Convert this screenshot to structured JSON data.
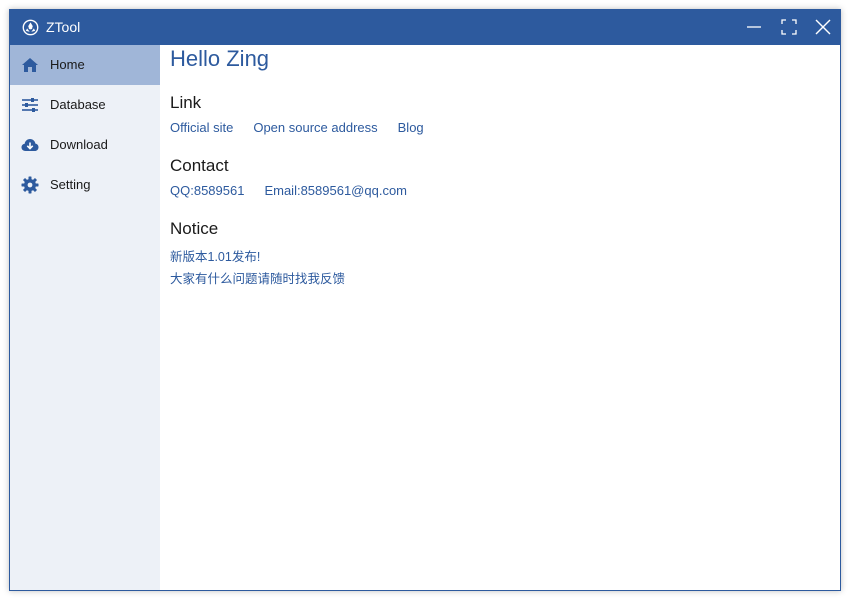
{
  "window": {
    "title": "ZTool",
    "accent_color": "#2d5a9e",
    "sidebar_bg": "#edf1f7",
    "active_item_bg": "#a0b6d8"
  },
  "sidebar": {
    "items": [
      {
        "label": "Home",
        "icon": "home-icon",
        "active": true
      },
      {
        "label": "Database",
        "icon": "sliders-icon",
        "active": false
      },
      {
        "label": "Download",
        "icon": "cloud-download-icon",
        "active": false
      },
      {
        "label": "Setting",
        "icon": "gear-icon",
        "active": false
      }
    ]
  },
  "main": {
    "greeting": "Hello Zing",
    "link_section": {
      "title": "Link",
      "links": [
        "Official site",
        "Open source address",
        "Blog"
      ]
    },
    "contact_section": {
      "title": "Contact",
      "items": [
        "QQ:8589561",
        "Email:8589561@qq.com"
      ]
    },
    "notice_section": {
      "title": "Notice",
      "lines": [
        "新版本1.01发布!",
        "大家有什么问题请随时找我反馈"
      ]
    }
  }
}
